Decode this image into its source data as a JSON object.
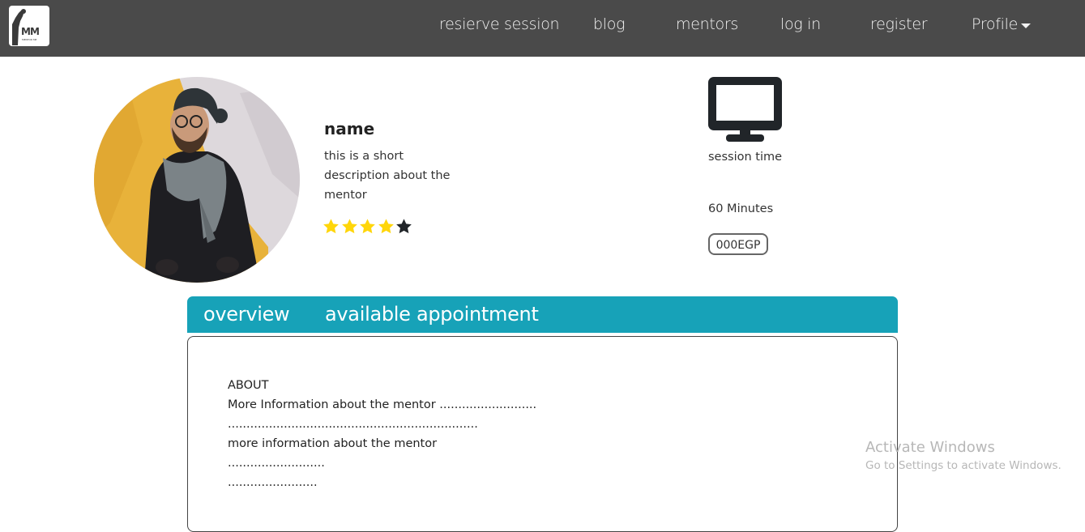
{
  "nav": {
    "logo_text": "MM",
    "logo_subtext": "MENTOR ME",
    "links": [
      "resierve session",
      "blog",
      "mentors",
      "log in",
      "register",
      "Profile"
    ]
  },
  "profile": {
    "name": "name",
    "description": "this is a short description about the mentor",
    "rating": 4,
    "rating_max": 5,
    "star_color": "#ffd60a",
    "star_empty_color": "#212529"
  },
  "session": {
    "icon": "monitor-icon",
    "label": "session time",
    "duration": "60 Minutes",
    "price": "000EGP"
  },
  "tabs": [
    "overview",
    "available appointment"
  ],
  "accent": "#17a2b8",
  "about": {
    "heading": "ABOUT",
    "lines": [
      "More Information about the mentor ..........................",
      "...................................................................",
      "more information about the mentor",
      "..........................",
      "........................"
    ]
  },
  "watermark": {
    "title": "Activate Windows",
    "subtitle": "Go to Settings to activate Windows."
  }
}
